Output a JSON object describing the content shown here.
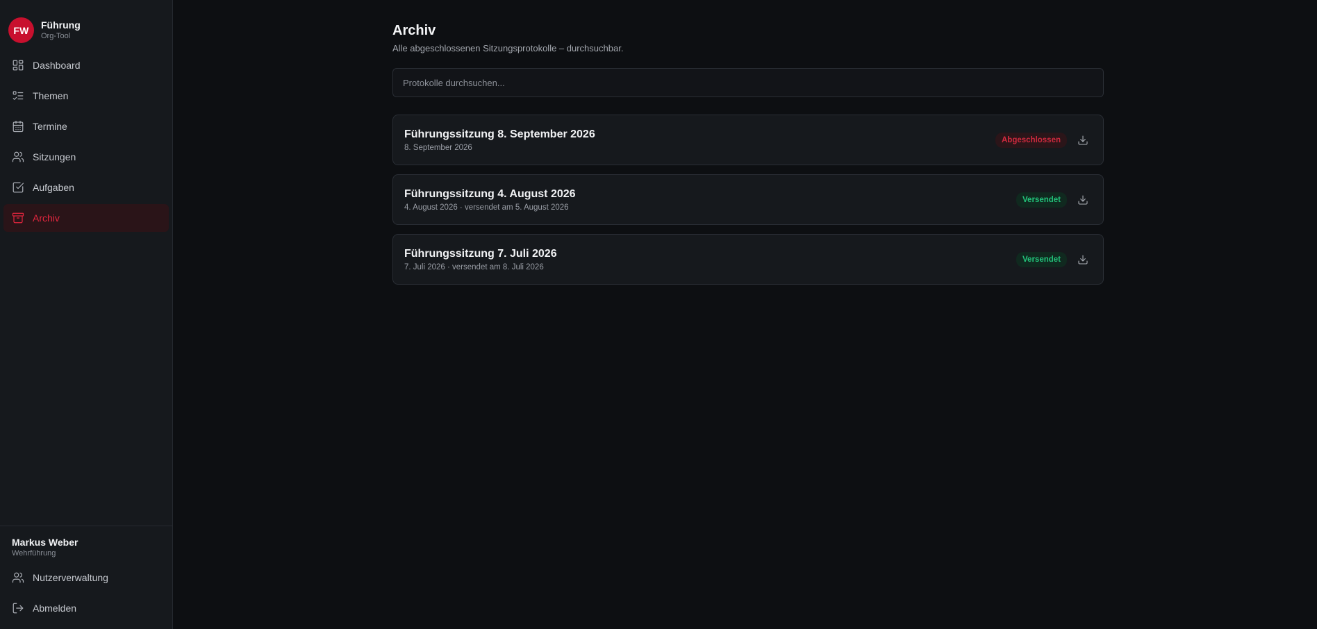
{
  "brand": {
    "initials": "FW",
    "name": "Führung",
    "subtitle": "Org-Tool"
  },
  "sidebar": {
    "items": [
      {
        "label": "Dashboard",
        "icon": "dashboard-icon"
      },
      {
        "label": "Themen",
        "icon": "list-checks-icon"
      },
      {
        "label": "Termine",
        "icon": "calendar-icon"
      },
      {
        "label": "Sitzungen",
        "icon": "users-icon"
      },
      {
        "label": "Aufgaben",
        "icon": "checkbox-icon"
      },
      {
        "label": "Archiv",
        "icon": "archive-icon",
        "active": true
      }
    ]
  },
  "user": {
    "name": "Markus Weber",
    "role": "Wehrführung"
  },
  "footer_nav": {
    "users_label": "Nutzerverwaltung",
    "logout_label": "Abmelden"
  },
  "page": {
    "title": "Archiv",
    "subtitle": "Alle abgeschlossenen Sitzungsprotokolle – durchsuchbar."
  },
  "search": {
    "placeholder": "Protokolle durchsuchen...",
    "value": ""
  },
  "protocols": [
    {
      "title": "Führungssitzung 8. September 2026",
      "meta": "8. September 2026",
      "status": "Abgeschlossen",
      "status_color": "#d32a3f"
    },
    {
      "title": "Führungssitzung 4. August 2026",
      "meta": "4. August 2026 · versendet am 5. August 2026",
      "status": "Versendet",
      "status_color": "#22c27a"
    },
    {
      "title": "Führungssitzung 7. Juli 2026",
      "meta": "7. Juli 2026 · versendet am 8. Juli 2026",
      "status": "Versendet",
      "status_color": "#22c27a"
    }
  ],
  "colors": {
    "accent": "#c8102e",
    "active_text": "#e5263f",
    "success": "#22c27a"
  }
}
